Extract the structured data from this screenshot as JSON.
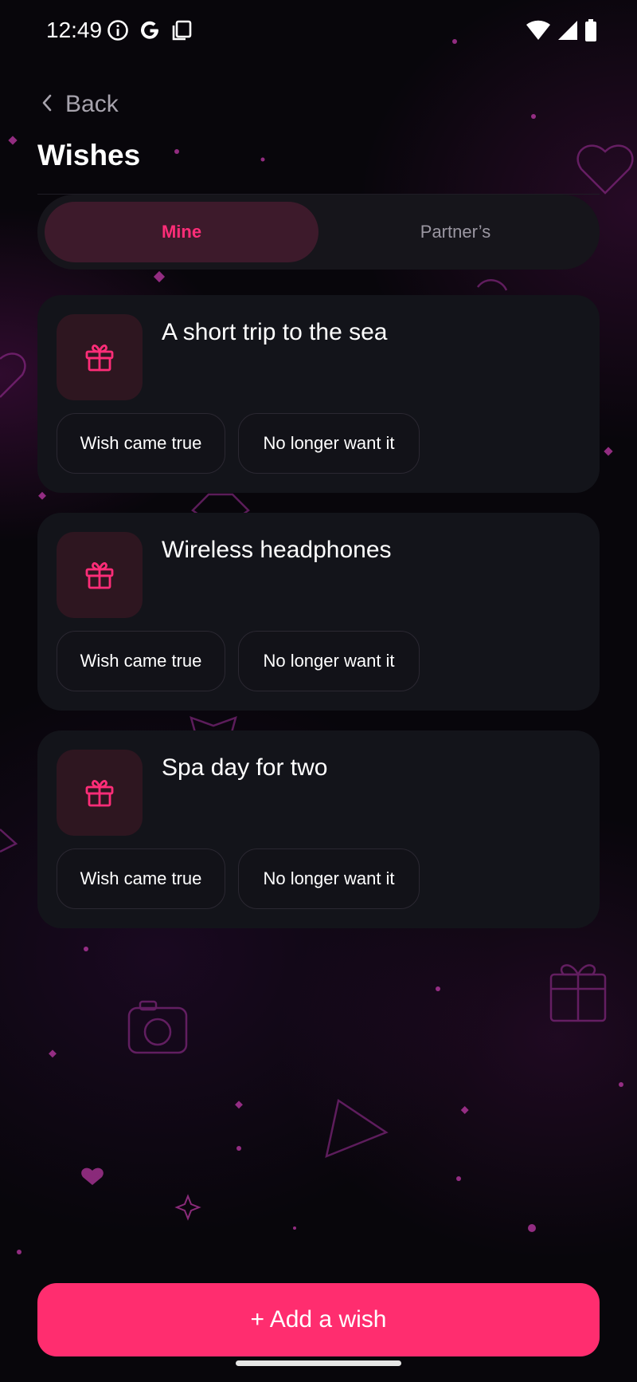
{
  "status_bar": {
    "time": "12:49",
    "left_icons": [
      "info-icon",
      "google-icon",
      "copy-icon"
    ],
    "right_icons": [
      "wifi-icon",
      "signal-icon",
      "battery-icon"
    ]
  },
  "header": {
    "back_label": "Back",
    "title": "Wishes"
  },
  "tabs": [
    {
      "label": "Mine",
      "active": true
    },
    {
      "label": "Partner’s",
      "active": false
    }
  ],
  "wishes": [
    {
      "title": "A short trip to the sea",
      "icon": "gift-icon",
      "came_true_label": "Wish came true",
      "no_longer_label": "No longer want it"
    },
    {
      "title": "Wireless headphones",
      "icon": "gift-icon",
      "came_true_label": "Wish came true",
      "no_longer_label": "No longer want it"
    },
    {
      "title": "Spa day for two",
      "icon": "gift-icon",
      "came_true_label": "Wish came true",
      "no_longer_label": "No longer want it"
    }
  ],
  "add_button_label": "+ Add a wish",
  "colors": {
    "accent": "#ff2d6f",
    "tab_active_text": "#ff2d78",
    "tab_active_bg": "#3d1a2b",
    "card_bg": "#13141a",
    "background": "#08060b"
  }
}
